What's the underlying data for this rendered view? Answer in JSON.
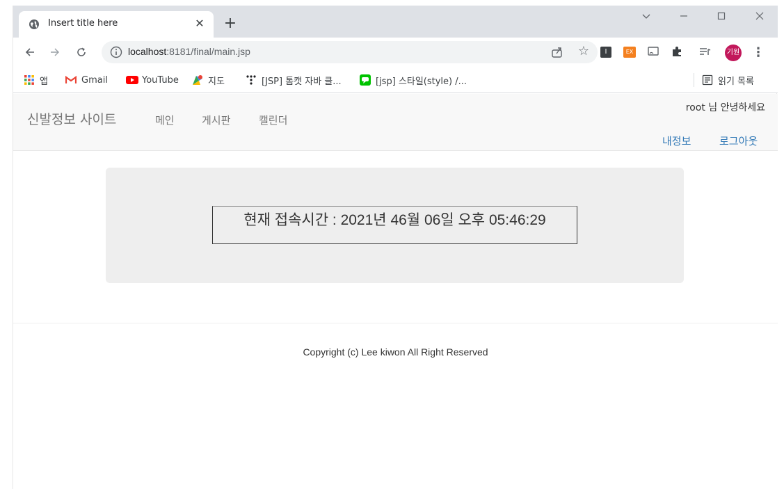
{
  "browser": {
    "tab_title": "Insert title here",
    "url_host": "localhost",
    "url_rest": ":8181/final/main.jsp",
    "profile_initials": "기원",
    "window_controls": [
      "minimize",
      "maximize",
      "close"
    ]
  },
  "bookmarks": [
    {
      "label": "앱",
      "icon": "apps-grid-icon"
    },
    {
      "label": "Gmail",
      "icon": "gmail-icon"
    },
    {
      "label": "YouTube",
      "icon": "youtube-icon"
    },
    {
      "label": "지도",
      "icon": "maps-icon"
    },
    {
      "label": "[JSP] 톰캣 자바 클...",
      "icon": "dots-icon"
    },
    {
      "label": "[jsp] 스타일(style) /...",
      "icon": "line-chat-icon"
    }
  ],
  "reading_list_label": "읽기 목록",
  "site": {
    "brand": "신발정보 사이트",
    "nav": [
      "메인",
      "게시판",
      "캘린더"
    ],
    "greeting": "root 님 안녕하세요",
    "my_info": "내정보",
    "logout": "로그아웃"
  },
  "clock_text": "현재 접속시간 : 2021년 46월 06일 오후 05:46:29",
  "footer": "Copyright (c) Lee kiwon All Right Reserved",
  "colors": {
    "tabstrip_bg": "#dee1e6",
    "navbar_bg": "#f8f8f8",
    "link_blue": "#337ab7",
    "jumbotron_bg": "#eeeeee",
    "profile_bg": "#c2185b"
  }
}
